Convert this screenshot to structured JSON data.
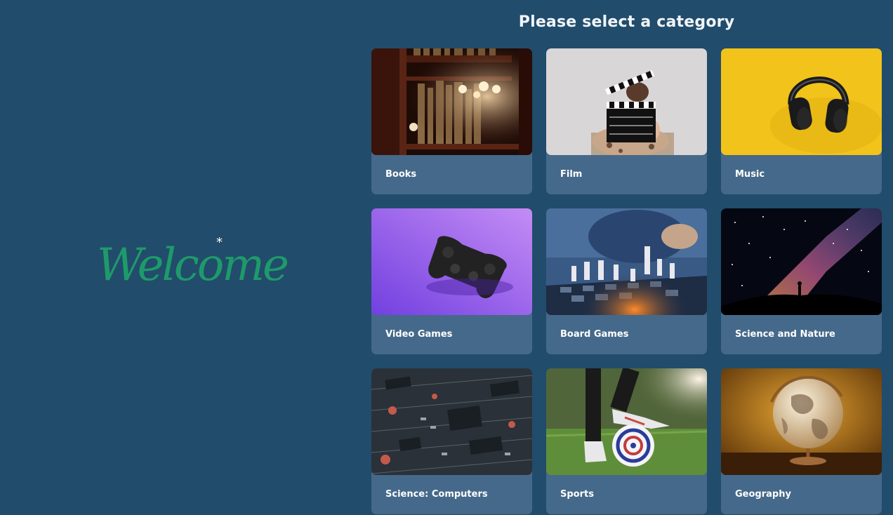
{
  "welcome": {
    "text": "Welcome",
    "sparkle": "*"
  },
  "heading": "Please select a category",
  "categories": [
    {
      "label": "Books",
      "icon": "bookshelf-photo"
    },
    {
      "label": "Film",
      "icon": "clapperboard-photo"
    },
    {
      "label": "Music",
      "icon": "headphones-photo"
    },
    {
      "label": "Video Games",
      "icon": "gamepad-photo"
    },
    {
      "label": "Board Games",
      "icon": "chess-photo"
    },
    {
      "label": "Science and Nature",
      "icon": "milky-way-photo"
    },
    {
      "label": "Science: Computers",
      "icon": "circuit-board-photo"
    },
    {
      "label": "Sports",
      "icon": "football-photo"
    },
    {
      "label": "Geography",
      "icon": "globe-photo"
    }
  ],
  "colors": {
    "background": "#214c6b",
    "card": "#45698a",
    "welcome": "#1e9a6a"
  }
}
